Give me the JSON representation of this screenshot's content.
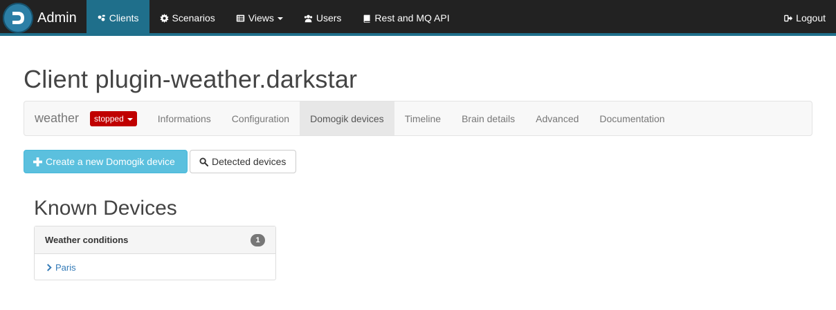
{
  "navbar": {
    "brand": "Admin",
    "items": [
      {
        "label": "Clients",
        "icon": "users-cog-icon",
        "active": true
      },
      {
        "label": "Scenarios",
        "icon": "gear-icon"
      },
      {
        "label": "Views",
        "icon": "list-icon",
        "dropdown": true
      },
      {
        "label": "Users",
        "icon": "users-icon"
      },
      {
        "label": "Rest and MQ API",
        "icon": "book-icon"
      }
    ],
    "logout": "Logout"
  },
  "page": {
    "title": "Client plugin-weather.darkstar"
  },
  "subnav": {
    "brand": "weather",
    "status": "stopped",
    "tabs": [
      "Informations",
      "Configuration",
      "Domogik devices",
      "Timeline",
      "Brain details",
      "Advanced",
      "Documentation"
    ],
    "active_tab": "Domogik devices"
  },
  "actions": {
    "create": "Create a new Domogik device",
    "detected": "Detected devices"
  },
  "known_devices": {
    "title": "Known Devices",
    "groups": [
      {
        "name": "Weather conditions",
        "count": "1",
        "devices": [
          "Paris"
        ]
      }
    ]
  },
  "colors": {
    "navbar_bg": "#222222",
    "accent": "#1f6f8b",
    "status_stopped": "#c00000",
    "info_button": "#5bc0de",
    "link": "#337ab7"
  }
}
